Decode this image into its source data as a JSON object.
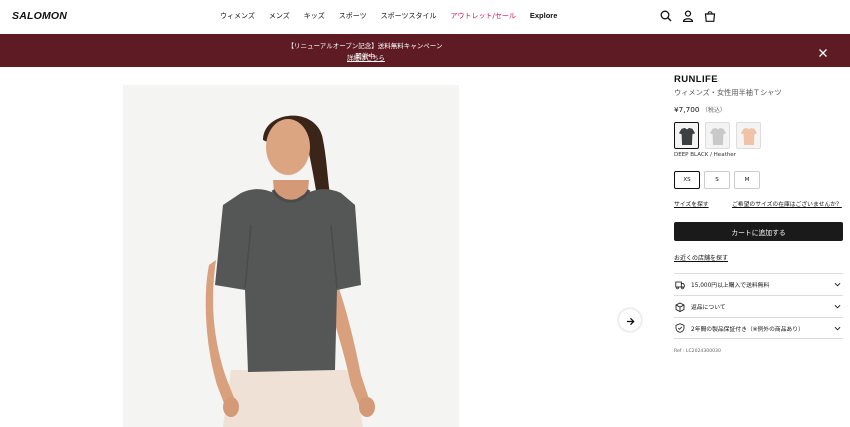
{
  "header": {
    "logo": "SALOMON",
    "nav": [
      "ウィメンズ",
      "メンズ",
      "キッズ",
      "スポーツ",
      "スポーツスタイル",
      "アウトレット/セール",
      "Explore"
    ],
    "icons": [
      "search-icon",
      "account-icon",
      "cart-bag-icon"
    ]
  },
  "banner": {
    "text": "【リニューアルオープン記念】送料無料キャンペーン開催中",
    "link": "詳細はこちら",
    "close_icon": "close-icon",
    "color": "#5e1b23"
  },
  "gallery": {
    "next_icon": "arrow-right-icon"
  },
  "product": {
    "name": "RUNLIFE",
    "subtitle": "ウィメンズ・女性用半袖Ｔシャツ",
    "price": "¥7,700",
    "tax_note": "（税込）",
    "color_name": "DEEP BLACK / Heather",
    "sizes": [
      "XS",
      "S",
      "M"
    ],
    "selected_size": "XS",
    "size_guide_link": "サイズを探す",
    "size_unavailable_link": "ご希望のサイズの在庫はございませんか？",
    "add_to_cart": "カートに追加する",
    "store_link": "お近くの店舗を探す",
    "accordion": [
      {
        "label": "15,000円以上購入で送料無料",
        "icon": "shipping-icon"
      },
      {
        "label": "返品について",
        "icon": "return-box-icon"
      },
      {
        "label": "2年間の製品保証付き（※例外の商品あり）",
        "icon": "shield-check-icon"
      }
    ],
    "ref": "Ref : LC2024300030"
  }
}
